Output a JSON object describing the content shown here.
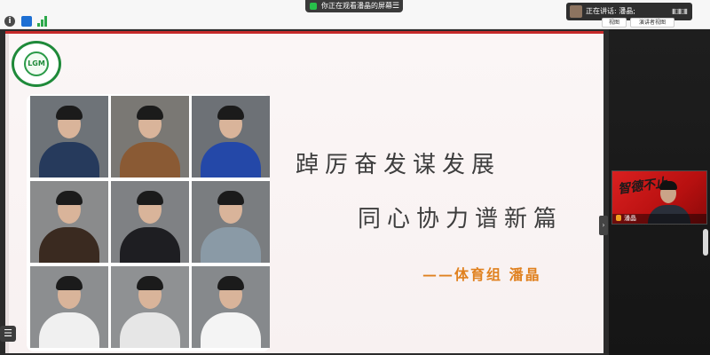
{
  "toolbar": {
    "info_icon": "i",
    "sharing_status": "你正在观看潘晶的屏幕",
    "sharing_menu_icon": "☰",
    "speaker_label": "正在讲话: 潘晶;",
    "speaker_wave": "▮▯▮▯▮",
    "view_chip_1": "视图",
    "view_chip_2": "演讲者视图"
  },
  "slide": {
    "logo_text": "LGM",
    "title_line1": "踔厉奋发谋发展",
    "title_line2": "同心协力谱新篇",
    "attribution": "——体育组 潘晶",
    "photo_bodies": [
      "#263a5c",
      "#8a5a34",
      "#2448a8",
      "#3a2a20",
      "#1e1e22",
      "#8a9aa6",
      "#f0f0f0",
      "#e6e6e6",
      "#f4f4f4"
    ],
    "photo_backgrounds": [
      "#6e7378",
      "#7a7874",
      "#6d7176",
      "#8a8b8c",
      "#7f8184",
      "#7a7d80",
      "#8c8e90",
      "#8f9193",
      "#86898c"
    ]
  },
  "controls": {
    "collapse_icon": "›",
    "list_icon": "☰"
  },
  "video": {
    "tile_calligraphy": "智德不止",
    "tile_name": "潘晶"
  },
  "colors": {
    "slide_accent": "#c62a2a",
    "attribution": "#e0811f",
    "logo_green": "#1f8a3a"
  }
}
